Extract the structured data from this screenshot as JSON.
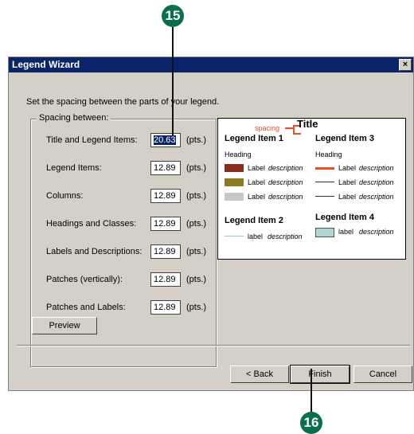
{
  "callouts": {
    "top": "15",
    "bottom": "16"
  },
  "window": {
    "title": "Legend Wizard",
    "close_glyph": "×"
  },
  "instruction": "Set the spacing between the parts of your legend.",
  "spacing_group": {
    "legend": "Spacing between:",
    "unit_label": "(pts.)",
    "rows": [
      {
        "label": "Title and Legend Items:",
        "value": "20.63"
      },
      {
        "label": "Legend Items:",
        "value": "12.89"
      },
      {
        "label": "Columns:",
        "value": "12.89"
      },
      {
        "label": "Headings and Classes:",
        "value": "12.89"
      },
      {
        "label": "Labels and Descriptions:",
        "value": "12.89"
      },
      {
        "label": "Patches (vertically):",
        "value": "12.89"
      },
      {
        "label": "Patches and Labels:",
        "value": "12.89"
      }
    ]
  },
  "preview": {
    "spacing_label": "spacing",
    "title": "Title",
    "item1": "Legend Item 1",
    "item2": "Legend Item 2",
    "item3": "Legend Item 3",
    "item4": "Legend Item 4",
    "heading": "Heading",
    "label": "Label",
    "label_lower": "label",
    "description": "description",
    "colors": {
      "red": "#8b2a1e",
      "olive": "#8a7a20",
      "gray": "#c8c8c8",
      "orange": "#e8502a",
      "cyan": "#80d0e0",
      "teal": "#b0d8d0",
      "accent": "#e8502a"
    }
  },
  "buttons": {
    "preview": "Preview",
    "back": "< Back",
    "finish": "Finish",
    "cancel": "Cancel"
  }
}
